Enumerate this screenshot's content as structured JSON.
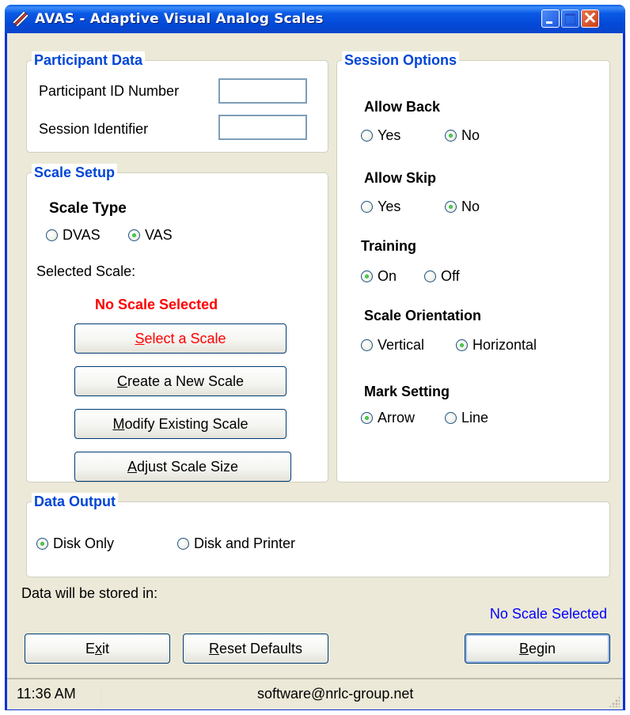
{
  "window": {
    "title": "AVAS - Adaptive Visual Analog Scales",
    "app_icon": "pencils-icon",
    "controls": {
      "minimize": "minimize-icon",
      "maximize": "maximize-icon",
      "close": "✕"
    }
  },
  "participant_data": {
    "title": "Participant Data",
    "participant_id_label": "Participant ID Number",
    "participant_id_value": "",
    "session_label": "Session Identifier",
    "session_value": ""
  },
  "scale_setup": {
    "title": "Scale Setup",
    "scale_type_label": "Scale Type",
    "scale_type_options": [
      {
        "label": "DVAS",
        "selected": false
      },
      {
        "label": "VAS",
        "selected": true
      }
    ],
    "selected_scale_label": "Selected Scale:",
    "selected_scale_value": "No Scale Selected",
    "selected_scale_color": "#ff0000",
    "buttons": [
      {
        "mnemonic": "S",
        "rest": "elect a Scale",
        "color": "#ff0000"
      },
      {
        "mnemonic": "C",
        "rest": "reate a New Scale"
      },
      {
        "mnemonic": "M",
        "rest": "odify Existing Scale"
      },
      {
        "mnemonic": "A",
        "rest": "djust Scale Size"
      }
    ]
  },
  "session_options": {
    "title": "Session Options",
    "groups": [
      {
        "label": "Allow Back",
        "options": [
          {
            "label": "Yes",
            "selected": false
          },
          {
            "label": "No",
            "selected": true
          }
        ]
      },
      {
        "label": "Allow Skip",
        "options": [
          {
            "label": "Yes",
            "selected": false
          },
          {
            "label": "No",
            "selected": true
          }
        ]
      },
      {
        "label": "Training",
        "options": [
          {
            "label": "On",
            "selected": true
          },
          {
            "label": "Off",
            "selected": false
          }
        ]
      },
      {
        "label": "Scale Orientation",
        "options": [
          {
            "label": "Vertical",
            "selected": false
          },
          {
            "label": "Horizontal",
            "selected": true
          }
        ]
      },
      {
        "label": "Mark Setting",
        "options": [
          {
            "label": "Arrow",
            "selected": true
          },
          {
            "label": "Line",
            "selected": false
          }
        ]
      }
    ]
  },
  "data_output": {
    "title": "Data Output",
    "options": [
      {
        "label": "Disk Only",
        "selected": true
      },
      {
        "label": "Disk and Printer",
        "selected": false
      }
    ]
  },
  "storage": {
    "label": "Data will be stored in:",
    "value": "No Scale Selected",
    "value_color": "#0000ff"
  },
  "footer_buttons": {
    "exit": {
      "before": "E",
      "mnemonic": "x",
      "after": "it"
    },
    "reset": {
      "mnemonic": "R",
      "rest": "eset Defaults"
    },
    "begin": {
      "mnemonic": "B",
      "rest": "egin"
    }
  },
  "statusbar": {
    "time": "11:36 AM",
    "email": "software@nrlc-group.net"
  },
  "colors": {
    "title_bar": "#0348d6",
    "group_title": "#0046d5",
    "window_bg": "#ece9d8",
    "radio_selected": "#1d9b1d"
  }
}
